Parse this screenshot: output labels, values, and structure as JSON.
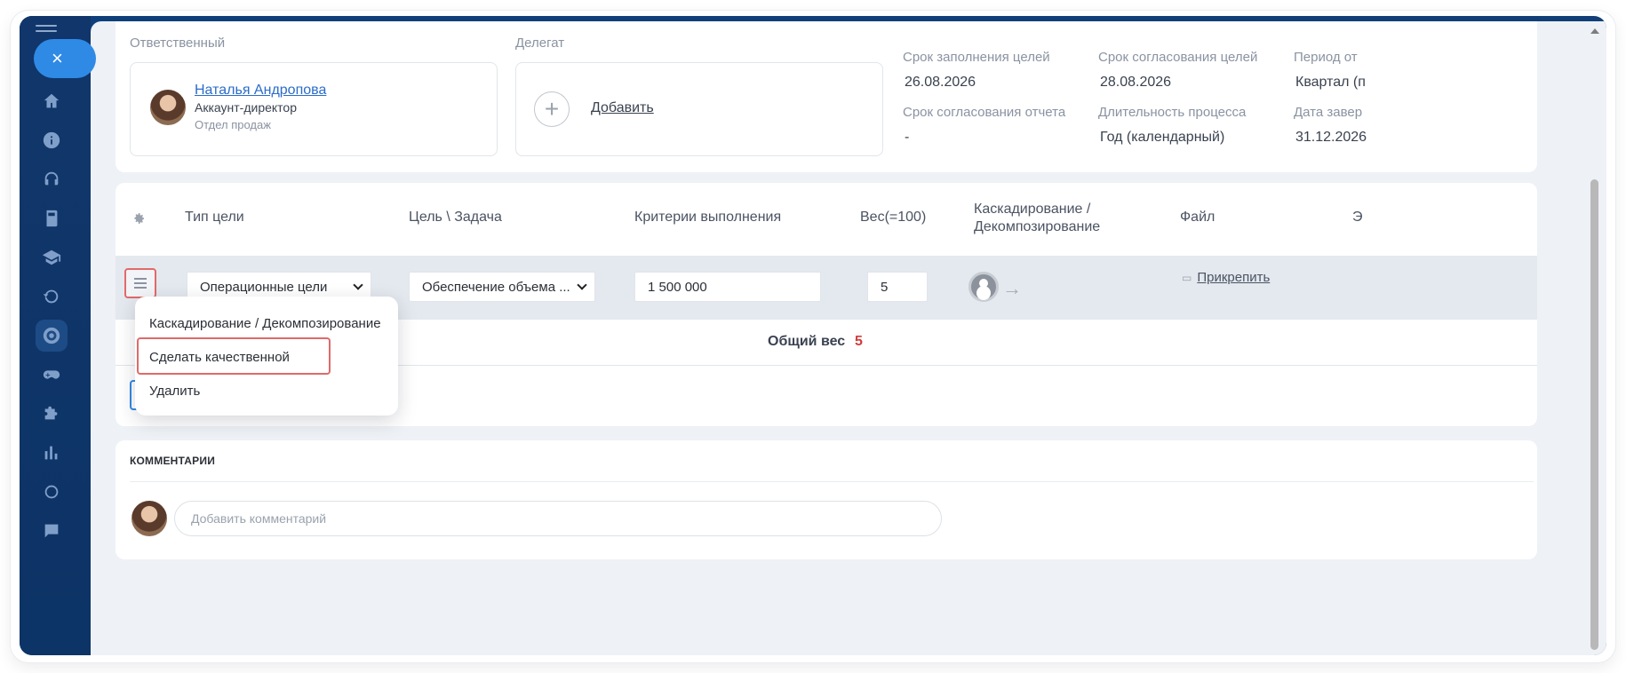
{
  "sidebar": {
    "close_label": "×",
    "icons": [
      "home-icon",
      "info-icon",
      "headset-icon",
      "book-icon",
      "graduation-cap-icon",
      "feedback-360-icon",
      "target-icon",
      "gamepad-icon",
      "puzzle-icon",
      "chart-icon",
      "circle-icon",
      "chat-icon"
    ]
  },
  "header": {
    "responsible_label": "Ответственный",
    "responsible": {
      "name": "Наталья Андропова",
      "role": "Аккаунт-директор",
      "department": "Отдел продаж"
    },
    "delegate_label": "Делегат",
    "delegate_add": "Добавить",
    "fields": [
      {
        "label": "Срок заполнения целей",
        "value": "26.08.2026"
      },
      {
        "label": "Срок согласования целей",
        "value": "28.08.2026"
      },
      {
        "label": "Период от",
        "value": "Квартал (п"
      },
      {
        "label": "Срок согласования отчета",
        "value": "-"
      },
      {
        "label": "Длительность процесса",
        "value": "Год (календарный)"
      },
      {
        "label": "Дата завер",
        "value": "31.12.2026"
      }
    ]
  },
  "goals_table": {
    "columns": [
      "Тип цели",
      "Цель \\ Задача",
      "Критерии выполнения",
      "Вес(=100)",
      "Каскадирование / Декомпозирование",
      "Файл",
      "Э"
    ],
    "row": {
      "goal_type": "Операционные цели",
      "goal": "Обеспечение объема ...",
      "criteria": "1 500 000",
      "weight": "5",
      "attach_label": "Прикрепить"
    },
    "total_label": "Общий вес",
    "total_value": "5"
  },
  "context_menu": {
    "items": [
      "Каскадирование / Декомпозирование",
      "Сделать качественной",
      "Удалить"
    ]
  },
  "comments": {
    "title": "КОММЕНТАРИИ",
    "placeholder": "Добавить комментарий"
  },
  "colors": {
    "accent": "#2f8ae6",
    "sidebar": "#11366b",
    "highlight": "#e06a6a",
    "total": "#d23b3b"
  }
}
